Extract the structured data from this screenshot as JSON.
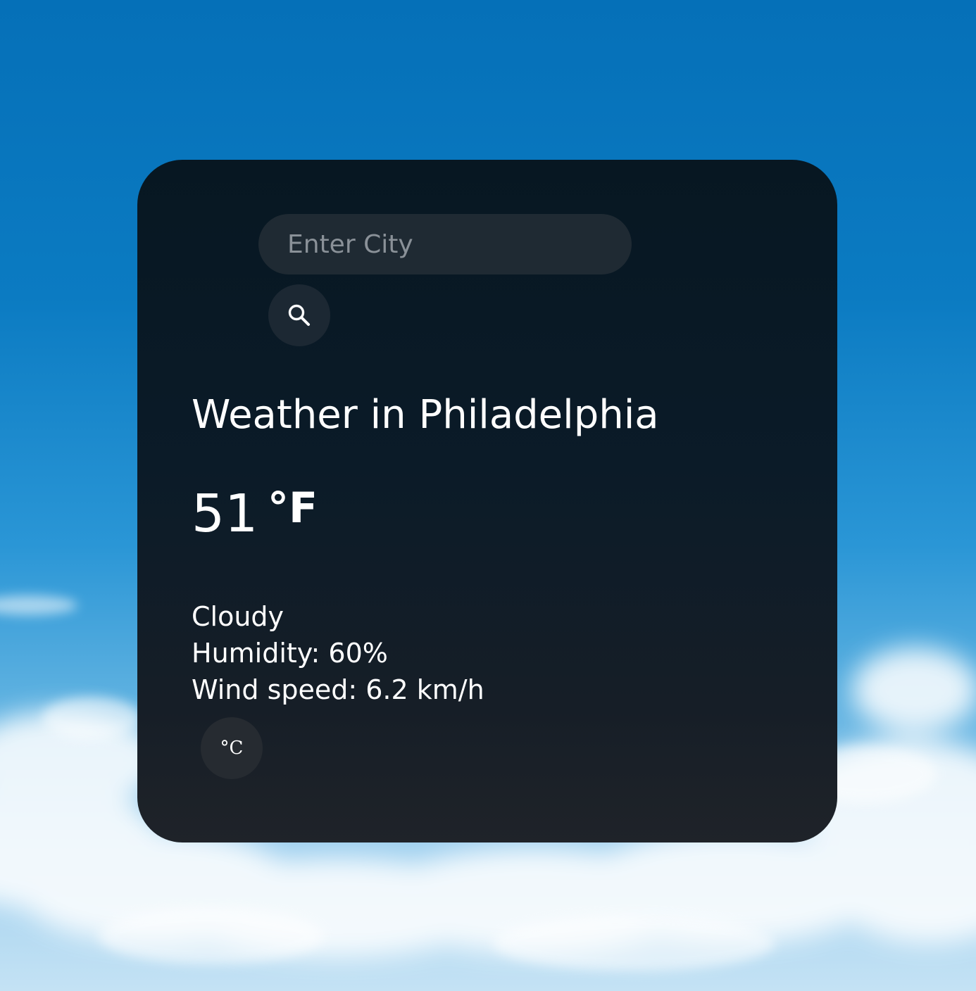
{
  "search": {
    "placeholder": "Enter City",
    "value": ""
  },
  "weather": {
    "title": "Weather in Philadelphia",
    "temperature": "51",
    "unit": "°F",
    "description": "Cloudy",
    "humidity": "Humidity: 60%",
    "wind": "Wind speed: 6.2 km/h"
  },
  "unit_toggle": {
    "label": "°C"
  },
  "icons": {
    "search": "search-icon"
  },
  "colors": {
    "sky_top": "#0570b8",
    "card_bg": "#0b1b28",
    "input_bg": "#1f2a33",
    "text": "#ffffff",
    "placeholder": "#8a9198"
  }
}
